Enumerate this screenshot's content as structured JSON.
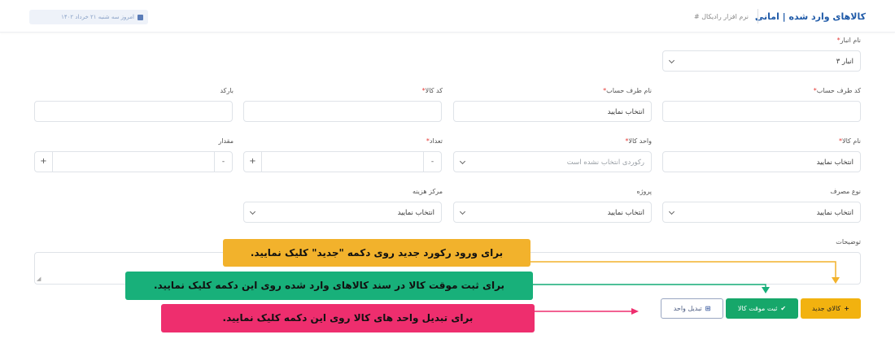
{
  "header": {
    "title": "کالاهای وارد شده | امانی",
    "breadcrumb": "# نرم افزار رادیکال",
    "date_text": "امروز سه شنبه ۲۱ خرداد ۱۴۰۲"
  },
  "form": {
    "warehouse": {
      "label": "نام انبار",
      "value": "انبار ۳"
    },
    "account_code": {
      "label": "کد طرف حساب",
      "value": ""
    },
    "account_name": {
      "label": "نام طرف حساب",
      "value": "انتخاب نمایید"
    },
    "item_code": {
      "label": "کد کالا",
      "value": ""
    },
    "barcode": {
      "label": "بارکد",
      "value": ""
    },
    "item_name": {
      "label": "نام کالا",
      "value": "انتخاب نمایید"
    },
    "unit": {
      "label": "واحد کالا",
      "placeholder": "رکوردی انتخاب نشده است"
    },
    "count": {
      "label": "تعداد",
      "minus": "-",
      "plus": "+"
    },
    "amount": {
      "label": "مقدار",
      "minus": "-",
      "plus": "+"
    },
    "usage_type": {
      "label": "نوع مصرف",
      "value": "انتخاب نمایید"
    },
    "project": {
      "label": "پروژه",
      "value": "انتخاب نمایید"
    },
    "cost_center": {
      "label": "مرکز هزینه",
      "value": "انتخاب نمایید"
    },
    "description": {
      "label": "توضیحات"
    },
    "required_mark": "*"
  },
  "buttons": {
    "new_item": "کالای جدید",
    "temp_save": "ثبت موقت کالا",
    "convert_unit": "تبدیل واحد"
  },
  "callouts": {
    "new_record": "برای ورود رکورد جدید روی دکمه \"جدید\" کلیک نمایید.",
    "temp_save": "برای ثبت موقت کالا در سند کالاهای وارد شده روی این دکمه کلیک نمایید.",
    "convert_unit": "برای تبدیل واحد های کالا روی این دکمه کلیک نمایید."
  },
  "colors": {
    "accent": "#1f5aa8",
    "new_button": "#f2b20f",
    "save_button": "#16a76a",
    "callout_yellow": "#f2b22c",
    "callout_green": "#18b07a",
    "callout_pink": "#ee2e6e"
  },
  "icons": {
    "new_item": "plus-icon",
    "temp_save": "check-icon",
    "convert_unit": "sitemap-icon",
    "date": "calendar-icon"
  }
}
